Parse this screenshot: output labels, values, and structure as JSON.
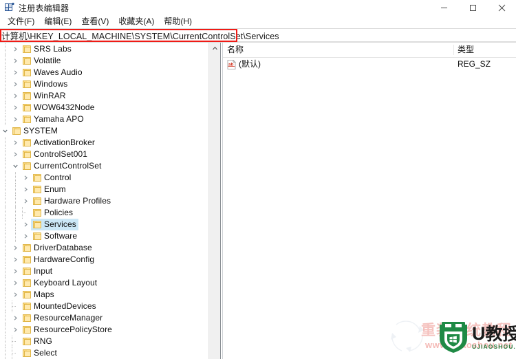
{
  "window": {
    "title": "注册表编辑器",
    "icon": "registry-editor-icon",
    "minimize_label": "—",
    "maximize_label": "□",
    "close_label": "✕"
  },
  "menu": {
    "items": [
      {
        "label": "文件(F)",
        "name": "menu-file"
      },
      {
        "label": "编辑(E)",
        "name": "menu-edit"
      },
      {
        "label": "查看(V)",
        "name": "menu-view"
      },
      {
        "label": "收藏夹(A)",
        "name": "menu-favorites"
      },
      {
        "label": "帮助(H)",
        "name": "menu-help"
      }
    ]
  },
  "address": {
    "path": "计算机\\HKEY_LOCAL_MACHINE\\SYSTEM\\CurrentControlSet\\Services",
    "highlight_color": "#ef1b16"
  },
  "tree": {
    "scrollbar_up_label": "⌃",
    "items": [
      {
        "label": "SRS Labs",
        "indent": 2,
        "state": "collapsed"
      },
      {
        "label": "Volatile",
        "indent": 2,
        "state": "collapsed"
      },
      {
        "label": "Waves Audio",
        "indent": 2,
        "state": "collapsed"
      },
      {
        "label": "Windows",
        "indent": 2,
        "state": "collapsed"
      },
      {
        "label": "WinRAR",
        "indent": 2,
        "state": "collapsed"
      },
      {
        "label": "WOW6432Node",
        "indent": 2,
        "state": "collapsed"
      },
      {
        "label": "Yamaha APO",
        "indent": 2,
        "state": "collapsed"
      },
      {
        "label": "SYSTEM",
        "indent": 1,
        "state": "expanded"
      },
      {
        "label": "ActivationBroker",
        "indent": 2,
        "state": "collapsed"
      },
      {
        "label": "ControlSet001",
        "indent": 2,
        "state": "collapsed"
      },
      {
        "label": "CurrentControlSet",
        "indent": 2,
        "state": "expanded"
      },
      {
        "label": "Control",
        "indent": 3,
        "state": "collapsed"
      },
      {
        "label": "Enum",
        "indent": 3,
        "state": "collapsed"
      },
      {
        "label": "Hardware Profiles",
        "indent": 3,
        "state": "collapsed"
      },
      {
        "label": "Policies",
        "indent": 3,
        "state": "leaf"
      },
      {
        "label": "Services",
        "indent": 3,
        "state": "collapsed",
        "selected": true
      },
      {
        "label": "Software",
        "indent": 3,
        "state": "collapsed"
      },
      {
        "label": "DriverDatabase",
        "indent": 2,
        "state": "collapsed"
      },
      {
        "label": "HardwareConfig",
        "indent": 2,
        "state": "collapsed"
      },
      {
        "label": "Input",
        "indent": 2,
        "state": "collapsed"
      },
      {
        "label": "Keyboard Layout",
        "indent": 2,
        "state": "collapsed"
      },
      {
        "label": "Maps",
        "indent": 2,
        "state": "collapsed"
      },
      {
        "label": "MountedDevices",
        "indent": 2,
        "state": "leaf"
      },
      {
        "label": "ResourceManager",
        "indent": 2,
        "state": "collapsed"
      },
      {
        "label": "ResourcePolicyStore",
        "indent": 2,
        "state": "collapsed"
      },
      {
        "label": "RNG",
        "indent": 2,
        "state": "leaf"
      },
      {
        "label": "Select",
        "indent": 2,
        "state": "leaf"
      }
    ]
  },
  "list": {
    "columns": [
      {
        "label": "名称",
        "name": "column-header-name"
      },
      {
        "label": "类型",
        "name": "column-header-type"
      }
    ],
    "rows": [
      {
        "name": "(默认)",
        "type": "REG_SZ",
        "icon": "registry-string-value-icon"
      }
    ]
  },
  "watermark": {
    "brand": "U教授",
    "brand_u": "U",
    "brand_cn": "教授",
    "url": "UJIAOSHOU.COM",
    "ghost_text": "重装系统教程",
    "ghost_url": "www.ujiaoshou.net",
    "shield_color": "#1f8a45"
  }
}
